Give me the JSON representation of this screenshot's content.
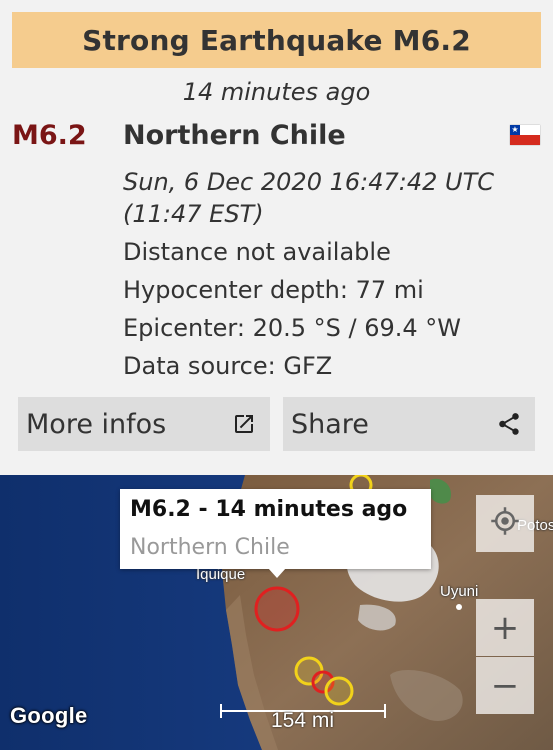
{
  "header": {
    "title": "Strong Earthquake M6.2",
    "time_ago": "14 minutes ago"
  },
  "quake": {
    "magnitude": "M6.2",
    "region": "Northern Chile",
    "flag_icon": "chile-flag-icon",
    "datetime_line1": "Sun, 6 Dec 2020 16:47:42 UTC",
    "datetime_line2": "(11:47 EST)",
    "distance": "Distance not available",
    "depth": "Hypocenter depth: 77 mi",
    "epicenter": "Epicenter: 20.5 °S / 69.4 °W",
    "source": "Data source: GFZ"
  },
  "actions": {
    "more_infos_label": "More infos",
    "more_infos_icon": "open-external-icon",
    "share_label": "Share",
    "share_icon": "share-icon"
  },
  "map": {
    "popup_title": "M6.2  -  14 minutes ago",
    "popup_subtitle": "Northern Chile",
    "place_iquique": "Iquique",
    "place_uyuni": "Uyuni",
    "place_potosi": "Potos",
    "scale_label": "154 mi",
    "attribution": "Google",
    "locate_icon": "my-location-icon",
    "zoom_in_label": "+",
    "zoom_out_label": "−",
    "colors": {
      "ocean": "#16387a",
      "land": "#8a6c50",
      "quake_red": "#e02020",
      "quake_yellow": "#f2d21a"
    }
  }
}
